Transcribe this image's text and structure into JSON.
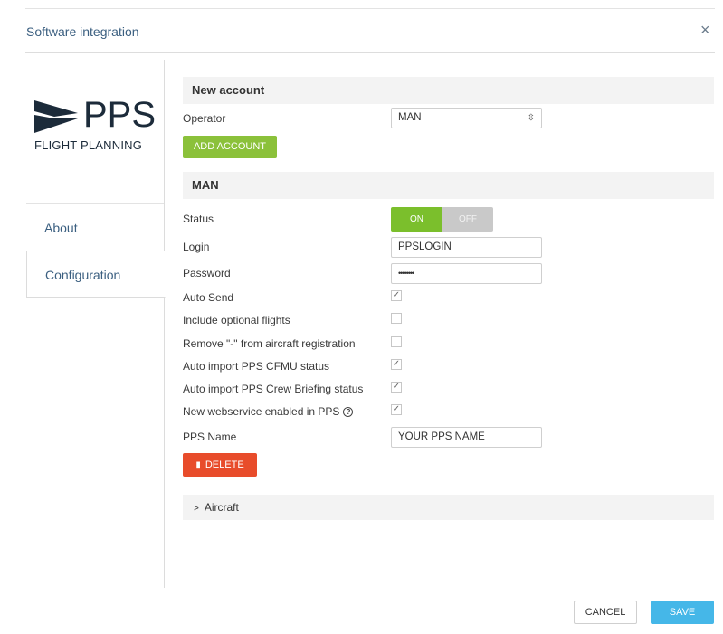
{
  "dialog": {
    "title": "Software integration",
    "close_label": "×"
  },
  "logo": {
    "brand": "PPS",
    "subtitle": "FLIGHT PLANNING"
  },
  "tabs": [
    {
      "label": "About"
    },
    {
      "label": "Configuration"
    }
  ],
  "new_account": {
    "heading": "New account",
    "operator_label": "Operator",
    "operator_value": "MAN",
    "add_button": "ADD ACCOUNT"
  },
  "account": {
    "heading": "MAN",
    "status_label": "Status",
    "status_on": "ON",
    "status_off": "OFF",
    "login_label": "Login",
    "login_value": "PPSLOGIN",
    "password_label": "Password",
    "password_value": "••••••••",
    "options": [
      {
        "label": "Auto Send",
        "checked": true
      },
      {
        "label": "Include optional flights",
        "checked": false
      },
      {
        "label": "Remove \"-\" from aircraft registration",
        "checked": false
      },
      {
        "label": "Auto import PPS CFMU status",
        "checked": true
      },
      {
        "label": "Auto import PPS Crew Briefing status",
        "checked": true
      },
      {
        "label": "New webservice enabled in PPS",
        "checked": true
      }
    ],
    "pps_name_label": "PPS Name",
    "pps_name_value": "YOUR PPS NAME",
    "delete_button": "DELETE",
    "aircraft_label": "Aircraft"
  },
  "footer": {
    "cancel": "CANCEL",
    "save": "SAVE"
  },
  "colors": {
    "accent_green": "#7bbf2c",
    "delete_red": "#e84c2b",
    "save_blue": "#45b7e8",
    "title_blue": "#3b5f80"
  }
}
